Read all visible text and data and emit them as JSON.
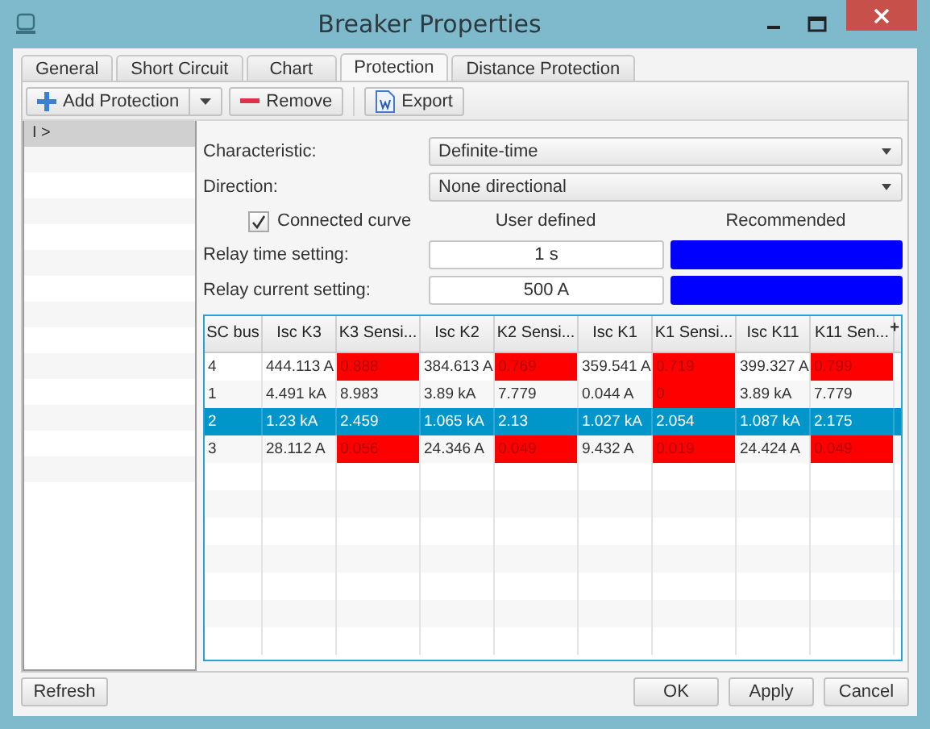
{
  "window": {
    "title": "Breaker Properties"
  },
  "tabs": [
    {
      "label": "General",
      "selected": false
    },
    {
      "label": "Short Circuit",
      "selected": false
    },
    {
      "label": "Chart",
      "selected": false
    },
    {
      "label": "Protection",
      "selected": true
    },
    {
      "label": "Distance Protection",
      "selected": false
    }
  ],
  "toolbar": {
    "add": "Add Protection",
    "remove": "Remove",
    "export": "Export"
  },
  "protections": [
    {
      "label": "I >",
      "selected": true
    }
  ],
  "characteristic": {
    "label": "Characteristic:",
    "value": "Definite-time"
  },
  "direction": {
    "label": "Direction:",
    "value": "None directional"
  },
  "connected_curve": {
    "label": "Connected curve",
    "checked": true
  },
  "headers": {
    "user": "User defined",
    "recommended": "Recommended"
  },
  "settings": [
    {
      "label": "Relay time setting:",
      "value": "1 s",
      "color": "#0000ff"
    },
    {
      "label": "Relay current setting:",
      "value": "500 A",
      "color": "#0000ff"
    }
  ],
  "table": {
    "columns": [
      "SC bus",
      "Isc K3",
      "K3 Sensi...",
      "Isc K2",
      "K2 Sensi...",
      "Isc K1",
      "K1 Sensi...",
      "Isc K11",
      "K11 Sen..."
    ],
    "menu_button": "+",
    "rows": [
      {
        "selected": false,
        "cells": [
          {
            "text": "4",
            "warn": false
          },
          {
            "text": "444.113 A",
            "warn": false
          },
          {
            "text": "0.888",
            "warn": true
          },
          {
            "text": "384.613 A",
            "warn": false
          },
          {
            "text": "0.769",
            "warn": true
          },
          {
            "text": "359.541 A",
            "warn": false
          },
          {
            "text": "0.719",
            "warn": true
          },
          {
            "text": "399.327 A",
            "warn": false
          },
          {
            "text": "0.799",
            "warn": true
          }
        ]
      },
      {
        "selected": false,
        "cells": [
          {
            "text": "1",
            "warn": false
          },
          {
            "text": "4.491 kA",
            "warn": false
          },
          {
            "text": "8.983",
            "warn": false
          },
          {
            "text": "3.89 kA",
            "warn": false
          },
          {
            "text": "7.779",
            "warn": false
          },
          {
            "text": "0.044 A",
            "warn": false
          },
          {
            "text": "0",
            "warn": true
          },
          {
            "text": "3.89 kA",
            "warn": false
          },
          {
            "text": "7.779",
            "warn": false
          }
        ]
      },
      {
        "selected": true,
        "cells": [
          {
            "text": "2",
            "warn": false
          },
          {
            "text": "1.23 kA",
            "warn": false
          },
          {
            "text": "2.459",
            "warn": false
          },
          {
            "text": "1.065 kA",
            "warn": false
          },
          {
            "text": "2.13",
            "warn": false
          },
          {
            "text": "1.027 kA",
            "warn": false
          },
          {
            "text": "2.054",
            "warn": false
          },
          {
            "text": "1.087 kA",
            "warn": false
          },
          {
            "text": "2.175",
            "warn": false
          }
        ]
      },
      {
        "selected": false,
        "cells": [
          {
            "text": "3",
            "warn": false
          },
          {
            "text": "28.112 A",
            "warn": false
          },
          {
            "text": "0.056",
            "warn": true
          },
          {
            "text": "24.346 A",
            "warn": false
          },
          {
            "text": "0.049",
            "warn": true
          },
          {
            "text": "9.432 A",
            "warn": false
          },
          {
            "text": "0.019",
            "warn": true
          },
          {
            "text": "24.424 A",
            "warn": false
          },
          {
            "text": "0.049",
            "warn": true
          }
        ]
      }
    ]
  },
  "buttons": {
    "refresh": "Refresh",
    "ok": "OK",
    "apply": "Apply",
    "cancel": "Cancel"
  }
}
